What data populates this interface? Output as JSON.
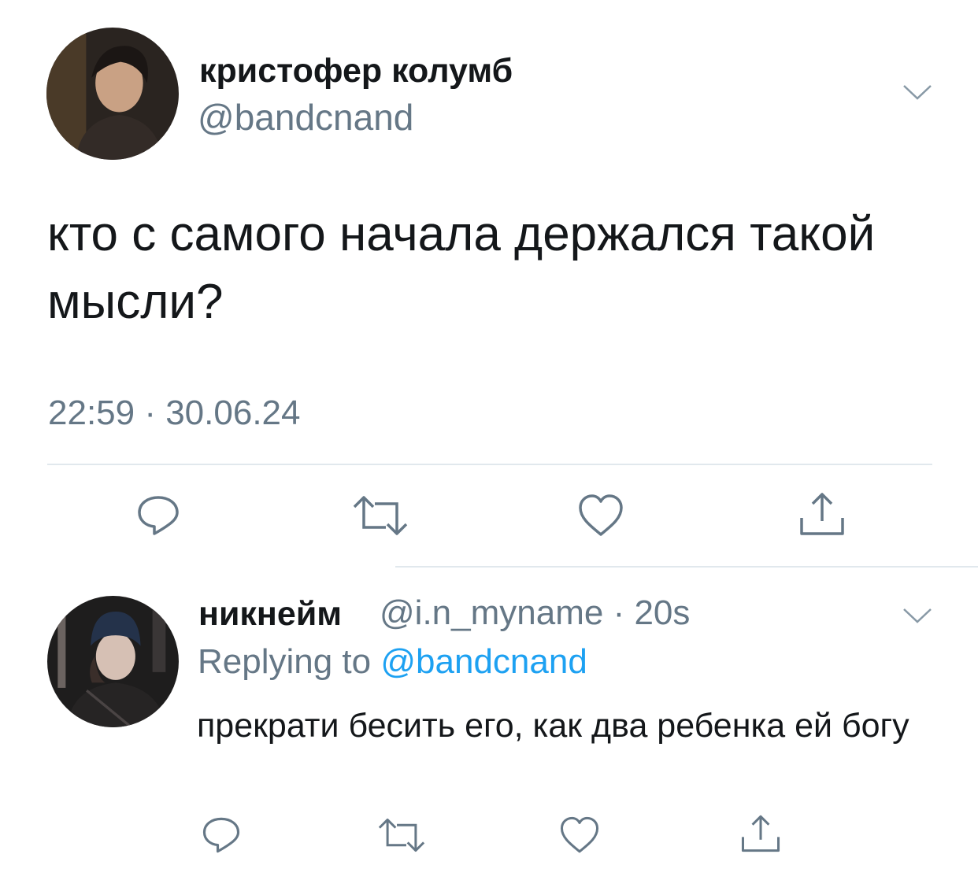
{
  "main_tweet": {
    "author_name": "кристофер колумб",
    "author_handle": "@bandcnand",
    "text": "кто с самого начала держался такой мысли?",
    "timestamp": "22:59 · 30.06.24",
    "icons": [
      "chevron-down-icon",
      "reply-icon",
      "retweet-icon",
      "like-icon",
      "share-icon"
    ]
  },
  "reply_tweet": {
    "author_name": "никнейм",
    "author_handle": "@i.n_myname",
    "separator": "·",
    "time_ago": "20s",
    "replying_prefix": "Replying to",
    "replying_mention": "@bandcnand",
    "text": "прекрати бесить его, как два ребенка ей богу",
    "icons": [
      "chevron-down-icon",
      "reply-icon",
      "retweet-icon",
      "like-icon",
      "share-icon"
    ]
  },
  "colors": {
    "text": "#14171a",
    "secondary": "#657786",
    "link": "#1da1f2",
    "divider": "#e1e8ed"
  }
}
